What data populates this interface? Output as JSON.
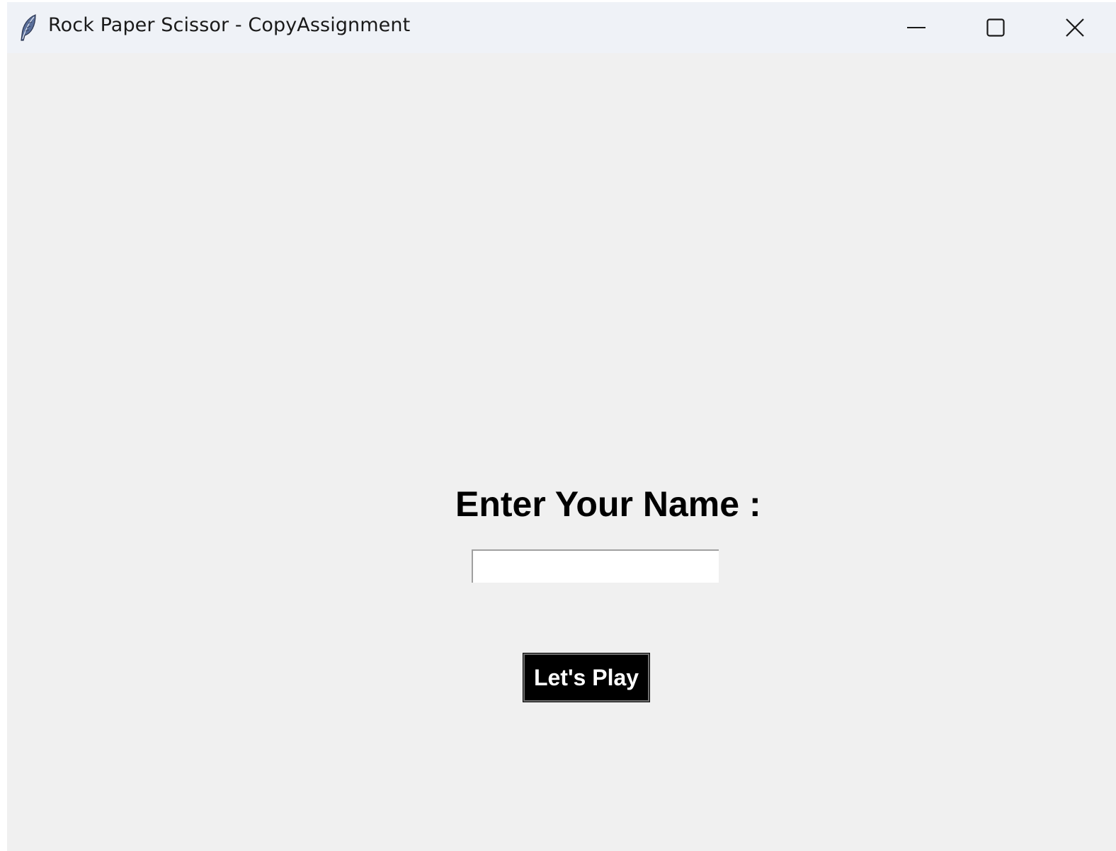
{
  "window": {
    "title": "Rock Paper Scissor - CopyAssignment",
    "app_icon": "feather-icon",
    "controls": {
      "minimize_icon": "minimize-icon",
      "maximize_icon": "maximize-icon",
      "close_icon": "close-icon"
    }
  },
  "main": {
    "prompt_label": "Enter Your Name :",
    "name_input": {
      "value": "",
      "placeholder": ""
    },
    "play_button_label": "Let's Play"
  },
  "colors": {
    "titlebar_bg": "#eff2f7",
    "window_bg": "#f0f0f0",
    "button_bg": "#000000",
    "button_text": "#ffffff"
  }
}
